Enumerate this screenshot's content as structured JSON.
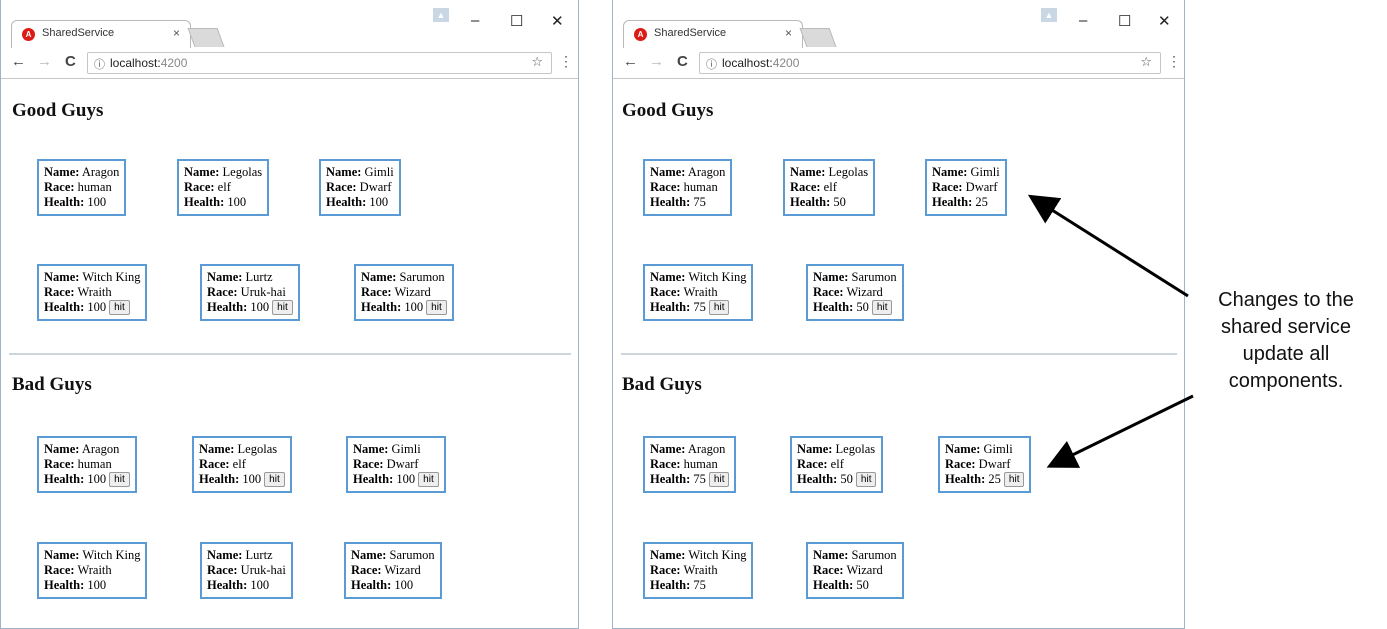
{
  "left_window": {
    "tab_title": "SharedService",
    "tab_close": "×",
    "url_host": "localhost:",
    "url_port": "4200",
    "good_heading": "Good Guys",
    "bad_heading": "Bad Guys",
    "good_row1": [
      {
        "name": "Aragon",
        "race": "human",
        "health": "100",
        "hit": false
      },
      {
        "name": "Legolas",
        "race": "elf",
        "health": "100",
        "hit": false
      },
      {
        "name": "Gimli",
        "race": "Dwarf",
        "health": "100",
        "hit": false
      }
    ],
    "good_row2": [
      {
        "name": "Witch King",
        "race": "Wraith",
        "health": "100",
        "hit": true
      },
      {
        "name": "Lurtz",
        "race": "Uruk-hai",
        "health": "100",
        "hit": true
      },
      {
        "name": "Sarumon",
        "race": "Wizard",
        "health": "100",
        "hit": true
      }
    ],
    "bad_row1": [
      {
        "name": "Aragon",
        "race": "human",
        "health": "100",
        "hit": true
      },
      {
        "name": "Legolas",
        "race": "elf",
        "health": "100",
        "hit": true
      },
      {
        "name": "Gimli",
        "race": "Dwarf",
        "health": "100",
        "hit": true
      }
    ],
    "bad_row2": [
      {
        "name": "Witch King",
        "race": "Wraith",
        "health": "100",
        "hit": false
      },
      {
        "name": "Lurtz",
        "race": "Uruk-hai",
        "health": "100",
        "hit": false
      },
      {
        "name": "Sarumon",
        "race": "Wizard",
        "health": "100",
        "hit": false
      }
    ]
  },
  "right_window": {
    "tab_title": "SharedService",
    "tab_close": "×",
    "url_host": "localhost:",
    "url_port": "4200",
    "good_heading": "Good Guys",
    "bad_heading": "Bad Guys",
    "good_row1": [
      {
        "name": "Aragon",
        "race": "human",
        "health": "75",
        "hit": false
      },
      {
        "name": "Legolas",
        "race": "elf",
        "health": "50",
        "hit": false
      },
      {
        "name": "Gimli",
        "race": "Dwarf",
        "health": "25",
        "hit": false
      }
    ],
    "good_row2": [
      {
        "name": "Witch King",
        "race": "Wraith",
        "health": "75",
        "hit": true
      },
      {
        "name": "Sarumon",
        "race": "Wizard",
        "health": "50",
        "hit": true
      }
    ],
    "bad_row1": [
      {
        "name": "Aragon",
        "race": "human",
        "health": "75",
        "hit": true
      },
      {
        "name": "Legolas",
        "race": "elf",
        "health": "50",
        "hit": true
      },
      {
        "name": "Gimli",
        "race": "Dwarf",
        "health": "25",
        "hit": true
      }
    ],
    "bad_row2": [
      {
        "name": "Witch King",
        "race": "Wraith",
        "health": "75",
        "hit": false
      },
      {
        "name": "Sarumon",
        "race": "Wizard",
        "health": "50",
        "hit": false
      }
    ]
  },
  "labels": {
    "name": "Name:",
    "race": "Race:",
    "health": "Health:",
    "hit": "hit"
  },
  "browser_chrome": {
    "favicon_glyph": "A",
    "back_icon": "←",
    "forward_icon": "→",
    "reload_icon": "C",
    "info_icon": "ⓘ",
    "star_icon": "☆",
    "menu_icon": "⋮",
    "minimize_icon": "–",
    "maximize_icon": "☐",
    "close_icon": "✕",
    "profile_icon": "▲"
  },
  "annotation": {
    "line1": "Changes to the",
    "line2": "shared service",
    "line3": "update all",
    "line4": "components."
  },
  "colors": {
    "card_border": "#5b9bd5",
    "favicon": "#dd1b16"
  }
}
